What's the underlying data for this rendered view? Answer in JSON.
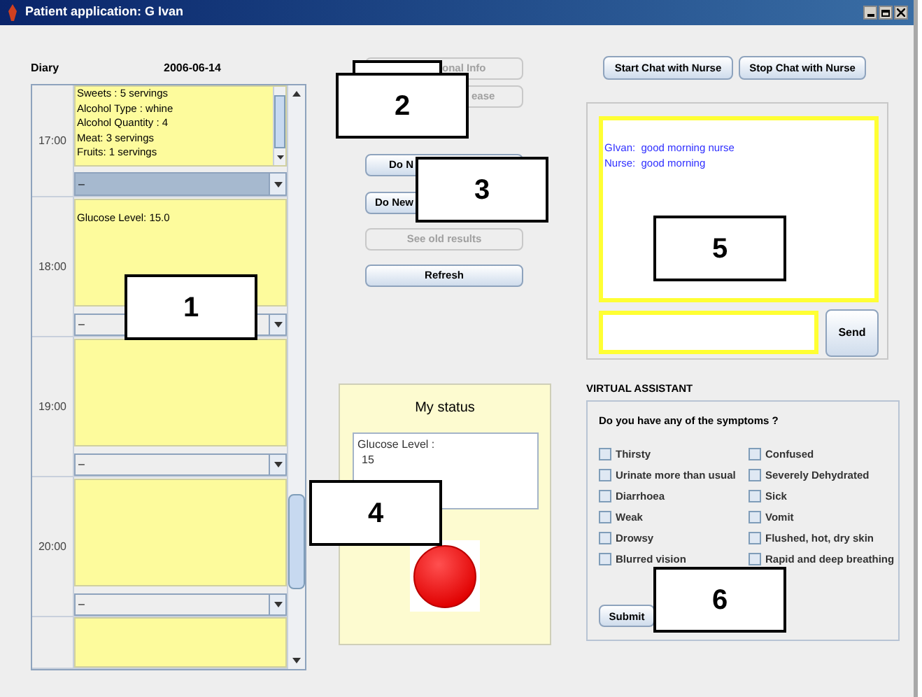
{
  "window": {
    "title": "Patient application: G Ivan"
  },
  "diary": {
    "label": "Diary",
    "date": "2006-06-14",
    "rows": [
      {
        "time": "17:00",
        "entry_lines": [
          "Sweets : 5 servings",
          "Alcohol Type : whine",
          "Alcohol Quantity : 4",
          "Meat: 3 servings",
          "Fruits: 1 servings"
        ],
        "choice": "–",
        "selected": true
      },
      {
        "time": "18:00",
        "entry_lines": [
          "Glucose Level: 15.0"
        ],
        "choice": "–",
        "selected": false
      },
      {
        "time": "19:00",
        "entry_lines": [],
        "choice": "–",
        "selected": false
      },
      {
        "time": "20:00",
        "entry_lines": [],
        "choice": "–",
        "selected": false
      },
      {
        "entry_lines": []
      }
    ]
  },
  "actions": [
    {
      "label": "onal Info",
      "disabled": true,
      "kind": "covered"
    },
    {
      "label": "ease",
      "disabled": true,
      "kind": "covered"
    },
    {
      "label": "Do N",
      "disabled": false,
      "kind": "covered"
    },
    {
      "label": "Do New",
      "disabled": false,
      "kind": "covered"
    },
    {
      "label": "See old results",
      "disabled": true,
      "kind": "plain"
    },
    {
      "label": "Refresh",
      "disabled": false,
      "kind": "plain"
    }
  ],
  "status": {
    "title": "My status",
    "reading_label": "Glucose Level :",
    "reading_value": "15"
  },
  "chat": {
    "buttons": [
      "Start Chat with Nurse",
      "Stop Chat with Nurse"
    ],
    "messages": [
      {
        "sender": "GIvan:",
        "text": "good morning nurse"
      },
      {
        "sender": "Nurse:",
        "text": "good morning"
      }
    ],
    "send": "Send"
  },
  "assistant": {
    "title": "VIRTUAL ASSISTANT",
    "question": "Do you have any of the symptoms ?",
    "symptoms": [
      {
        "label": "Thirsty",
        "checked": false
      },
      {
        "label": "Confused",
        "checked": false
      },
      {
        "label": "Urinate more than usual",
        "checked": false
      },
      {
        "label": "Severely Dehydrated",
        "checked": false
      },
      {
        "label": "Diarrhoea",
        "checked": false
      },
      {
        "label": "Sick",
        "checked": false
      },
      {
        "label": "Weak",
        "checked": false
      },
      {
        "label": "Vomit",
        "checked": false
      },
      {
        "label": "Drowsy",
        "checked": false
      },
      {
        "label": "Flushed, hot, dry skin",
        "checked": false
      },
      {
        "label": "Blurred vision",
        "checked": false
      },
      {
        "label": "Rapid and deep breathing",
        "checked": false
      }
    ],
    "submit": "Submit"
  },
  "callouts": [
    "1",
    "2",
    "3",
    "4",
    "5",
    "6"
  ]
}
